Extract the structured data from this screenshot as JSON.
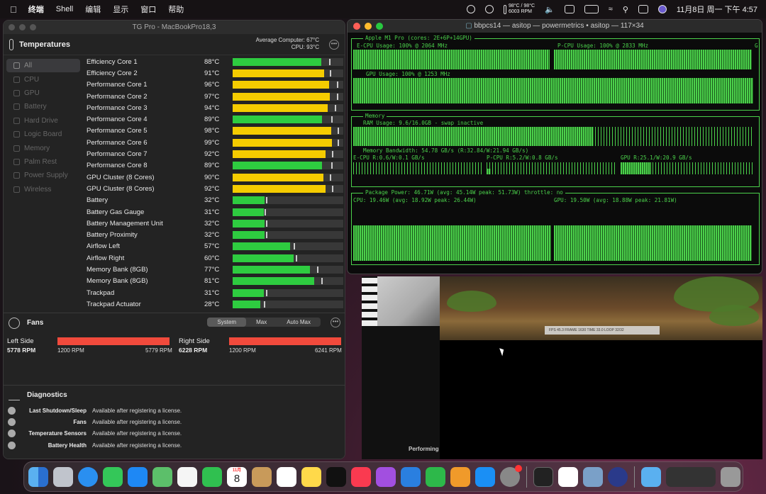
{
  "menubar": {
    "items": [
      "终端",
      "Shell",
      "编辑",
      "显示",
      "窗口",
      "帮助"
    ],
    "temp_line1": "98°C / 98°C",
    "temp_line2": "6003 RPM",
    "clock": "11月8日 周一 下午 4:57"
  },
  "tgpro": {
    "title": "TG Pro - MacBookPro18,3",
    "header": "Temperatures",
    "avg_label": "Average Computer:",
    "avg_value": "67°C",
    "cpu_label": "CPU:",
    "cpu_value": "93°C",
    "sidebar": [
      "All",
      "CPU",
      "GPU",
      "Battery",
      "Hard Drive",
      "Logic Board",
      "Memory",
      "Palm Rest",
      "Power Supply",
      "Wireless"
    ],
    "sensors": [
      {
        "name": "Efficiency Core 1",
        "temp": "88°C",
        "level": 0.8,
        "max": 0.87,
        "color": "#2ecc40"
      },
      {
        "name": "Efficiency Core 2",
        "temp": "91°C",
        "level": 0.83,
        "max": 0.88,
        "color": "#f5cc00"
      },
      {
        "name": "Performance Core 1",
        "temp": "96°C",
        "level": 0.87,
        "max": 0.94,
        "color": "#f5cc00"
      },
      {
        "name": "Performance Core 2",
        "temp": "97°C",
        "level": 0.88,
        "max": 0.94,
        "color": "#f5cc00"
      },
      {
        "name": "Performance Core 3",
        "temp": "94°C",
        "level": 0.86,
        "max": 0.92,
        "color": "#f5cc00"
      },
      {
        "name": "Performance Core 4",
        "temp": "89°C",
        "level": 0.81,
        "max": 0.89,
        "color": "#2ecc40"
      },
      {
        "name": "Performance Core 5",
        "temp": "98°C",
        "level": 0.89,
        "max": 0.95,
        "color": "#f5cc00"
      },
      {
        "name": "Performance Core 6",
        "temp": "99°C",
        "level": 0.9,
        "max": 0.95,
        "color": "#f5cc00"
      },
      {
        "name": "Performance Core 7",
        "temp": "92°C",
        "level": 0.84,
        "max": 0.9,
        "color": "#f5cc00"
      },
      {
        "name": "Performance Core 8",
        "temp": "89°C",
        "level": 0.81,
        "max": 0.89,
        "color": "#2ecc40"
      },
      {
        "name": "GPU Cluster (8 Cores)",
        "temp": "90°C",
        "level": 0.82,
        "max": 0.88,
        "color": "#f5cc00"
      },
      {
        "name": "GPU Cluster (8 Cores)",
        "temp": "92°C",
        "level": 0.84,
        "max": 0.9,
        "color": "#f5cc00"
      },
      {
        "name": "Battery",
        "temp": "32°C",
        "level": 0.29,
        "max": 0.3,
        "color": "#2ecc40"
      },
      {
        "name": "Battery Gas Gauge",
        "temp": "31°C",
        "level": 0.28,
        "max": 0.29,
        "color": "#2ecc40"
      },
      {
        "name": "Battery Management Unit",
        "temp": "32°C",
        "level": 0.29,
        "max": 0.3,
        "color": "#2ecc40"
      },
      {
        "name": "Battery Proximity",
        "temp": "32°C",
        "level": 0.29,
        "max": 0.3,
        "color": "#2ecc40"
      },
      {
        "name": "Airflow Left",
        "temp": "57°C",
        "level": 0.52,
        "max": 0.55,
        "color": "#2ecc40"
      },
      {
        "name": "Airflow Right",
        "temp": "60°C",
        "level": 0.55,
        "max": 0.57,
        "color": "#2ecc40"
      },
      {
        "name": "Memory Bank (8GB)",
        "temp": "77°C",
        "level": 0.7,
        "max": 0.76,
        "color": "#2ecc40"
      },
      {
        "name": "Memory Bank (8GB)",
        "temp": "81°C",
        "level": 0.74,
        "max": 0.8,
        "color": "#2ecc40"
      },
      {
        "name": "Trackpad",
        "temp": "31°C",
        "level": 0.28,
        "max": 0.3,
        "color": "#2ecc40"
      },
      {
        "name": "Trackpad Actuator",
        "temp": "28°C",
        "level": 0.25,
        "max": 0.28,
        "color": "#2ecc40"
      }
    ],
    "fans": {
      "header": "Fans",
      "modes": [
        "System",
        "Max",
        "Auto Max"
      ],
      "left": {
        "label": "Left Side",
        "rpm": "5778 RPM",
        "min": "1200 RPM",
        "max": "5779 RPM"
      },
      "right": {
        "label": "Right Side",
        "rpm": "6228 RPM",
        "min": "1200 RPM",
        "max": "6241 RPM"
      }
    },
    "diagnostics": {
      "header": "Diagnostics",
      "rows": [
        {
          "label": "Last Shutdown/Sleep",
          "value": "Available after registering a license."
        },
        {
          "label": "Fans",
          "value": "Available after registering a license."
        },
        {
          "label": "Temperature Sensors",
          "value": "Available after registering a license."
        },
        {
          "label": "Battery Health",
          "value": "Available after registering a license."
        }
      ]
    }
  },
  "terminal": {
    "title": "bbpcs14 — asitop — powermetrics • asitop — 117×34",
    "chip": "Apple M1 Pro (cores: 2E+6P+14GPU)",
    "ecpu": "E-CPU Usage: 100% @ 2064 MHz",
    "pcpu": "P-CPU Usage: 100% @ 2833 MHz",
    "gpu": "GPU Usage: 100% @ 1253 MHz",
    "gchar": "G",
    "memory": "Memory",
    "ram": "RAM Usage: 9.6/16.0GB - swap inactive",
    "membw": "Memory Bandwidth: 54.78 GB/s (R:32.84/W:21.94 GB/s)",
    "ecpubw": "E-CPU R:0.6/W:0.1 GB/s",
    "pcpubw": "P-CPU R:5.2/W:0.8 GB/s",
    "gpubw": "GPU R:25.1/W:20.9 GB/s",
    "pkg": "Package Power: 46.71W (avg: 45.14W peak: 51.73W) throttle: no",
    "cpupw": "CPU: 19.46W (avg: 18.92W peak: 26.44W)",
    "gpupw": "GPU: 19.50W (avg: 18.88W peak: 21.81W)"
  },
  "background": {
    "performing": "Performing",
    "hud": "FPS 45.3   FRAME 1630   TIME 33.0   LOOP 32/32"
  },
  "dock": {
    "calendar_month": "11月",
    "calendar_day": "8",
    "apps": [
      "finder-icon",
      "launchpad-icon",
      "safari-icon",
      "messages-icon",
      "mail-icon",
      "maps-icon",
      "photos-icon",
      "facetime-icon",
      "calendar-icon",
      "contacts-icon",
      "reminders-icon",
      "notes-icon",
      "tv-icon",
      "music-icon",
      "podcasts-icon",
      "keynote-icon",
      "numbers-icon",
      "pages-icon",
      "app-store-icon",
      "system-preferences-icon",
      "terminal-icon",
      "3dmark-icon",
      "preview-icon",
      "cinema4d-icon",
      "downloads-folder-icon",
      "window-stack-icon",
      "trash-icon"
    ]
  }
}
